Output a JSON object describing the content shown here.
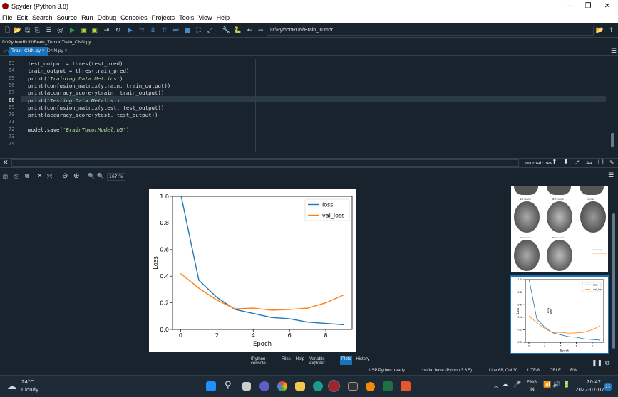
{
  "window": {
    "title": "Spyder (Python 3.8)",
    "minimize": "—",
    "maximize": "❐",
    "close": "✕"
  },
  "menu": [
    "File",
    "Edit",
    "Search",
    "Source",
    "Run",
    "Debug",
    "Consoles",
    "Projects",
    "Tools",
    "View",
    "Help"
  ],
  "toolbar": {
    "path": "D:\\PythonRUN\\Brain_Tumor"
  },
  "editor": {
    "file_path": "D:\\PythonRUN\\Brain_Tumor\\Train_CNN.py",
    "tabs": [
      {
        "label": "Train_CNN.py",
        "close": "×"
      },
      {
        "label": "DNN.py",
        "close": "×"
      }
    ],
    "current_line": 68,
    "lines": [
      {
        "no": "63",
        "code": "test_output = thres(test_pred)"
      },
      {
        "no": "64",
        "code": "train_output = thres(train_pred)"
      },
      {
        "no": "65",
        "code": "print(",
        "str": "'Training Data Metrics'",
        "tail": ")"
      },
      {
        "no": "66",
        "code": "print(confusion_matrix(ytrain, train_output))"
      },
      {
        "no": "67",
        "code": "print(accuracy_score(ytrain, train_output))"
      },
      {
        "no": "68",
        "code": "print(",
        "str": "'Testing Data Metrics'",
        "tail": ")"
      },
      {
        "no": "69",
        "code": "print(confusion_matrix(ytest, test_output))"
      },
      {
        "no": "70",
        "code": "print(accuracy_score(ytest, test_output))"
      },
      {
        "no": "71",
        "code": ""
      },
      {
        "no": "72",
        "code": "model.save(",
        "str": "'BrainTumorModel.h5'",
        "tail": ")"
      },
      {
        "no": "73",
        "code": ""
      },
      {
        "no": "74",
        "code": ""
      }
    ]
  },
  "find": {
    "status": "no matches",
    "case": "Aa"
  },
  "plots": {
    "zoom": "167 %"
  },
  "chart_data": {
    "type": "line",
    "x": [
      0,
      1,
      2,
      3,
      4,
      5,
      6,
      7,
      8,
      9
    ],
    "series": [
      {
        "name": "loss",
        "color": "#1f77b4",
        "values": [
          1.02,
          0.37,
          0.24,
          0.15,
          0.12,
          0.09,
          0.08,
          0.055,
          0.045,
          0.035
        ]
      },
      {
        "name": "val_loss",
        "color": "#ff7f0e",
        "values": [
          0.42,
          0.31,
          0.22,
          0.155,
          0.16,
          0.145,
          0.15,
          0.16,
          0.2,
          0.26
        ]
      }
    ],
    "xlabel": "Epoch",
    "ylabel": "Loss",
    "xlim": [
      -0.45,
      9.45
    ],
    "ylim": [
      0.0,
      1.0
    ],
    "xticks": [
      0,
      2,
      4,
      6,
      8
    ],
    "yticks": [
      "0.0",
      "0.2",
      "0.4",
      "0.6",
      "0.8",
      "1.0"
    ],
    "legend": "top-right"
  },
  "thumbs": {
    "mri_labels": [
      "Not cancer",
      "Not cancer",
      "Cancer",
      "Not cancer",
      "Not cancer"
    ],
    "legend_labels": [
      "accuracy",
      "val_accuracy"
    ],
    "mini_legend": [
      "loss",
      "val_loss"
    ],
    "mini_xlabel": "Epoch",
    "mini_ylabel": "Loss"
  },
  "pane_tabs": [
    "IPython console",
    "Files",
    "Help",
    "Variable explorer",
    "Plots",
    "History"
  ],
  "status": {
    "lsp": "LSP Python: ready",
    "conda": "conda: base (Python 3.8.5)",
    "pos": "Line 68, Col 30",
    "enc": "UTF-8",
    "eol": "CRLF",
    "rw": "RW"
  },
  "taskbar": {
    "temp": "24°C",
    "weather": "Cloudy",
    "lang1": "ENG",
    "lang2": "IN",
    "time": "20:42",
    "date": "2022-07-07",
    "badge": "25"
  },
  "colors": {
    "bg": "#19232d",
    "border": "#32414b",
    "accent": "#1a72bb"
  }
}
